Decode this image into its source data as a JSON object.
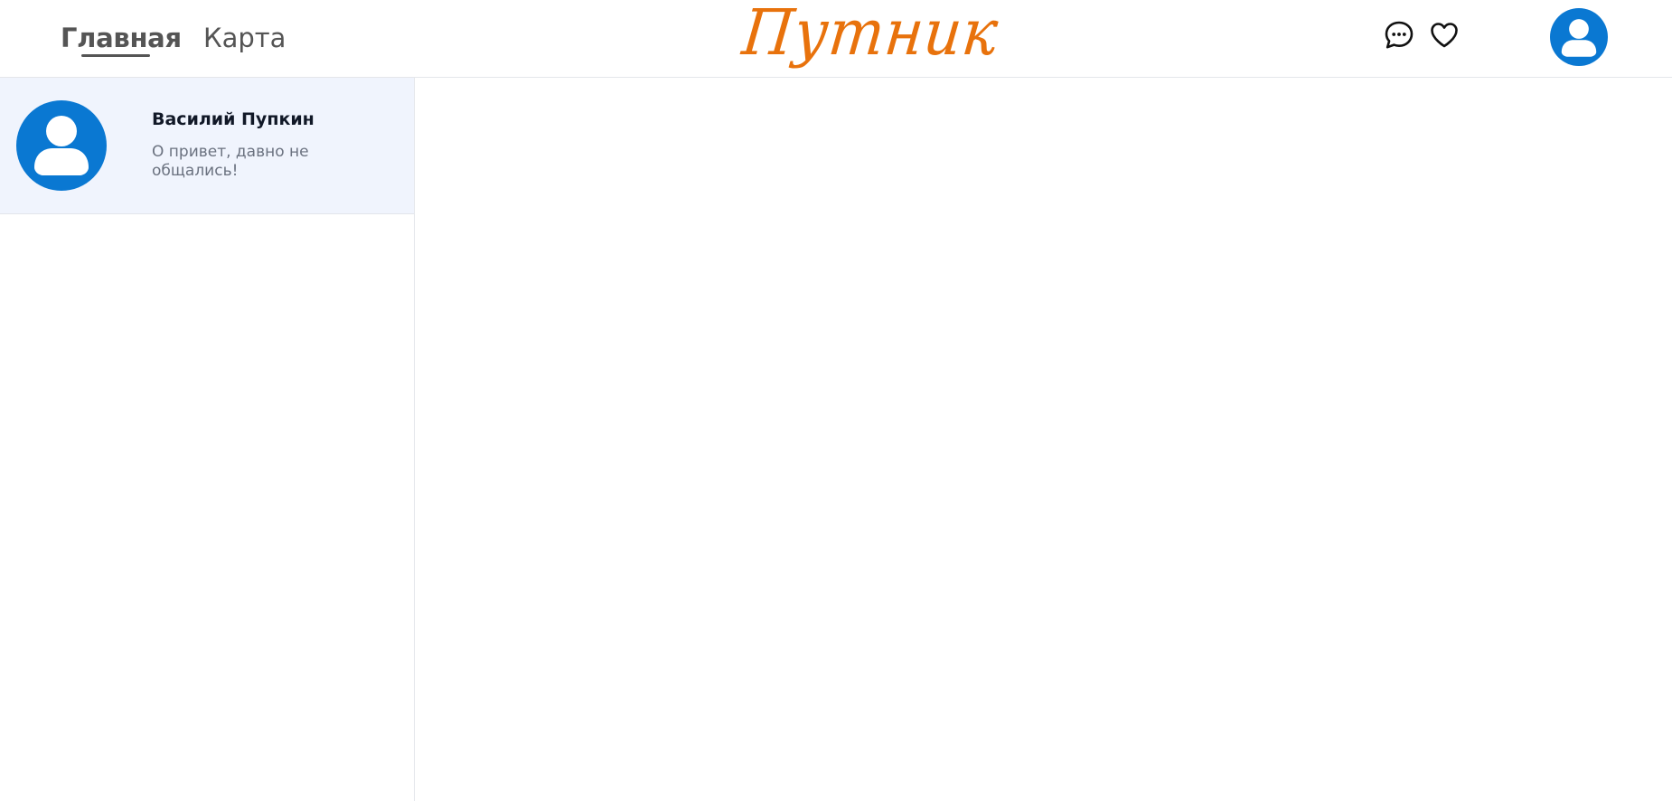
{
  "header": {
    "nav": {
      "home_label": "Главная",
      "map_label": "Карта"
    },
    "brand": "Путник",
    "icons": {
      "messages": "chat-bubble-icon",
      "favorites": "heart-icon",
      "profile": "user-avatar-icon"
    }
  },
  "sidebar": {
    "conversations": [
      {
        "name": "Василий Пупкин",
        "preview": "О привет, давно не общались!",
        "avatar_icon": "user-avatar-icon",
        "selected": true
      }
    ]
  },
  "colors": {
    "brand": "#e8720c",
    "avatar": "#0a78d2",
    "selected_item_bg": "#f0f4fd",
    "nav_text": "#555555"
  }
}
